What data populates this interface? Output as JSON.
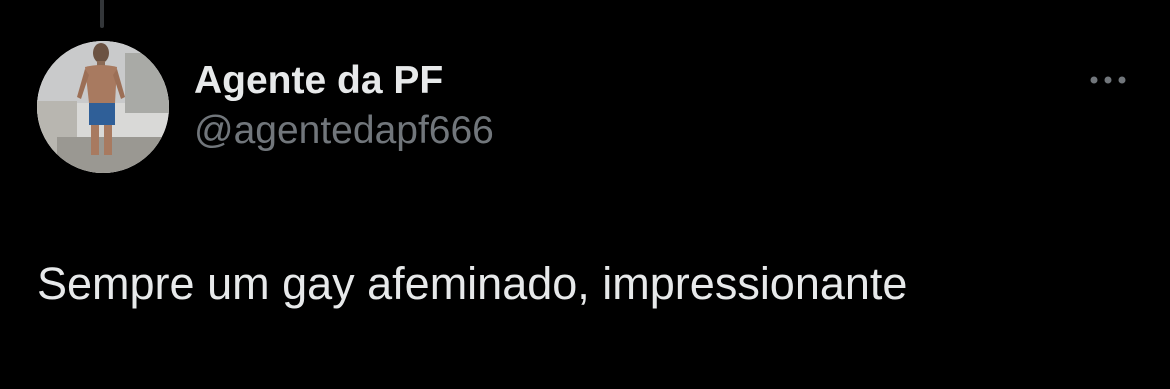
{
  "tweet": {
    "author": {
      "display_name": "Agente da PF",
      "handle": "@agentedapf666",
      "avatar_icon": "profile-photo"
    },
    "text": "Sempre um gay afeminado, impressionante",
    "more_icon": "more-horizontal-icon"
  },
  "colors": {
    "background": "#000000",
    "primary_text": "#e7e9ea",
    "secondary_text": "#71767b",
    "thread_line": "#333639"
  }
}
